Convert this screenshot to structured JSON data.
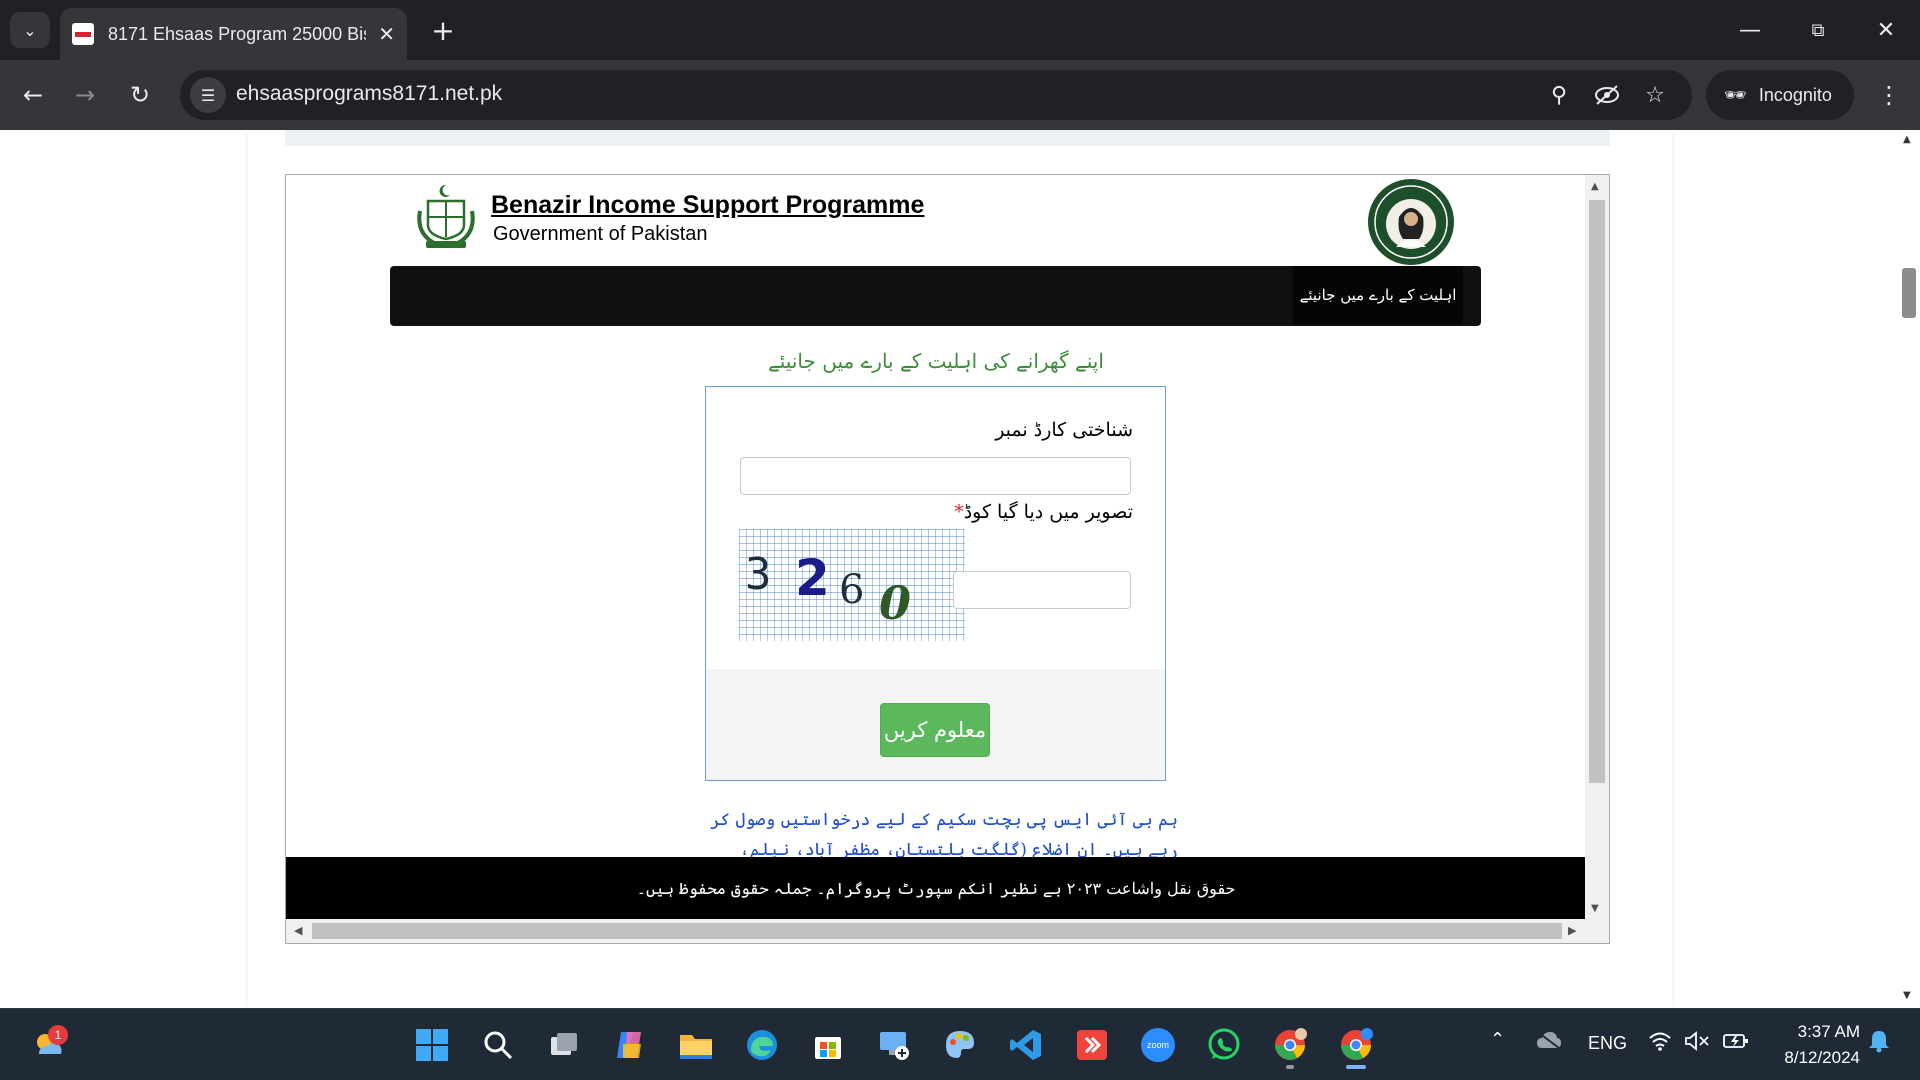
{
  "browser": {
    "tab_title": "8171 Ehsaas Program 25000 Bisp",
    "url": "ehsaasprograms8171.net.pk",
    "incognito_label": "Incognito"
  },
  "page": {
    "org_title": "Benazir Income Support Programme",
    "org_subtitle": "Government of Pakistan",
    "nav_item": "اہلیت کے بارے میں جانیئے",
    "heading": "اپنے گھرانے کی اہلیت کے بارے میں جانیئے",
    "form": {
      "cnic_label": "شناختی کارڈ نمبر",
      "cnic_value": "",
      "captcha_label": "تصویر میں دیا گیا کوڈ",
      "captcha_required": "*",
      "captcha_chars": [
        "3",
        "2",
        "6",
        "0"
      ],
      "captcha_value": "",
      "submit_label": "معلوم کریں"
    },
    "info_text": "ہم بی آئی ایس پی بچت سکیم کے لیے درخواستیں وصول کر رہے ہیں۔ ان اضلاع (گلگت بلتستان، مظفر آباد، نیلم، دیامر، لکی مروت، کرک، وزیرستان) کے افراد یہاں درخواست دے سکتے ہیں۔",
    "footer": "حقوق نقل واشاعت ۲۰۲۳ بے نظیر انکم سپورٹ پروگرام۔ جملہ حقوق محفوظ ہیں۔"
  },
  "taskbar": {
    "language": "ENG",
    "time": "3:37 AM",
    "date": "8/12/2024",
    "weather_badge": "1",
    "zoom_label": "zoom"
  },
  "colors": {
    "chrome_dark": "#202124",
    "chrome_toolbar": "#35363a",
    "heading_green": "#3d8c3a",
    "button_green": "#5cb85c",
    "form_border": "#6d9ed1",
    "info_blue": "#1e4fd1",
    "required_red": "#d9262a"
  }
}
